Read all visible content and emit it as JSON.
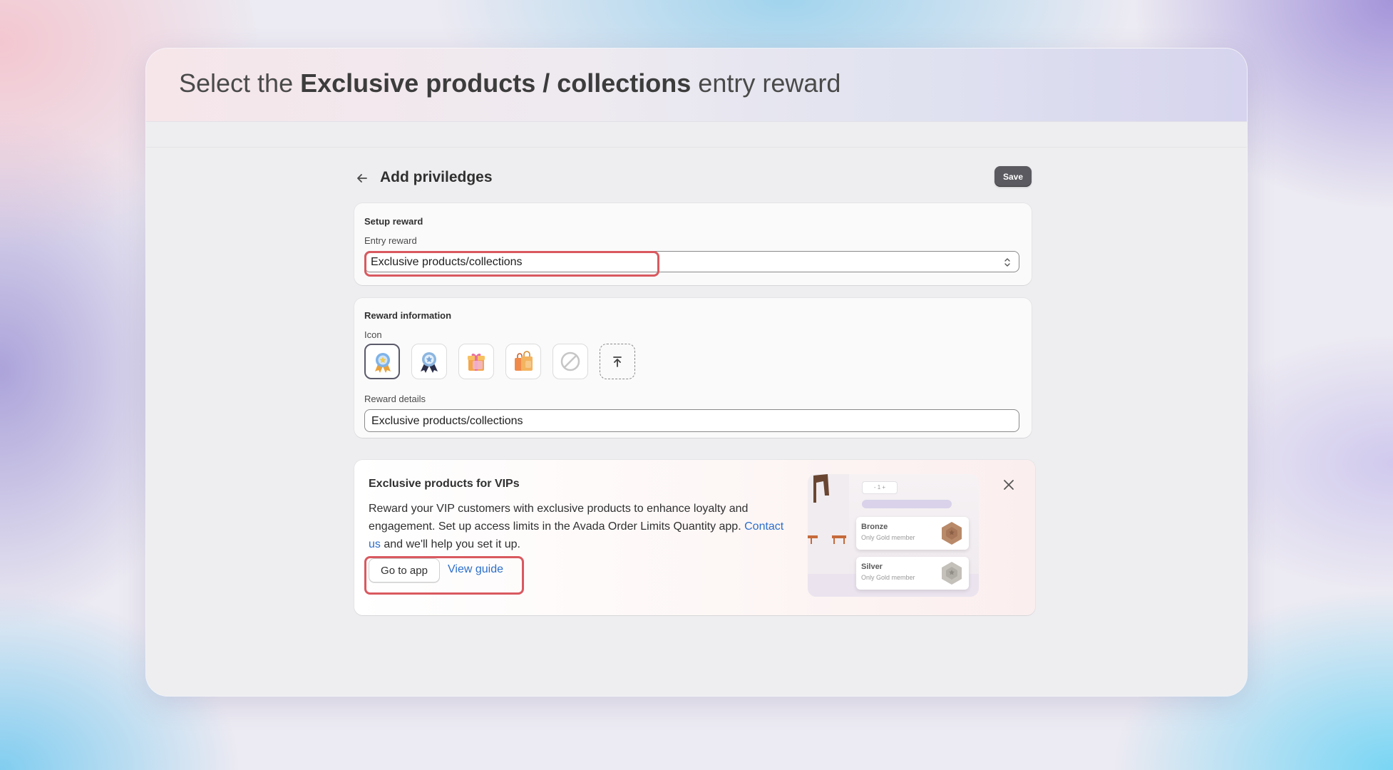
{
  "instruction": {
    "prefix": "Select the ",
    "emphasis": "Exclusive products / collections",
    "suffix": " entry reward"
  },
  "page": {
    "title": "Add priviledges",
    "save_label": "Save"
  },
  "setup_reward": {
    "heading": "Setup reward",
    "entry_label": "Entry reward",
    "entry_value": "Exclusive products/collections"
  },
  "reward_info": {
    "heading": "Reward information",
    "icon_label": "Icon",
    "icons": [
      "medal-icon",
      "ribbon-badge-icon",
      "gift-box-icon",
      "shopping-bags-icon",
      "no-icon",
      "upload-icon"
    ],
    "details_label": "Reward details",
    "details_value": "Exclusive products/collections"
  },
  "promo": {
    "title": "Exclusive products for VIPs",
    "body": "Reward your VIP customers with exclusive products to enhance loyalty and engagement. Set up access limits in the Avada Order Limits Quantity app.",
    "contact_link": "Contact us",
    "body_tail": " and we'll help you set it up.",
    "go_to_app": "Go to app",
    "view_guide": "View guide",
    "illustration": {
      "stepper": "- 1 +",
      "tiers": [
        {
          "name": "Bronze",
          "note": "Only Gold member",
          "color": "#b98a6a"
        },
        {
          "name": "Silver",
          "note": "Only Gold member",
          "color": "#b8b4ae"
        }
      ]
    }
  },
  "colors": {
    "highlight": "#d9595f",
    "link": "#2c6ecb",
    "save_button": "#5a5a60"
  }
}
